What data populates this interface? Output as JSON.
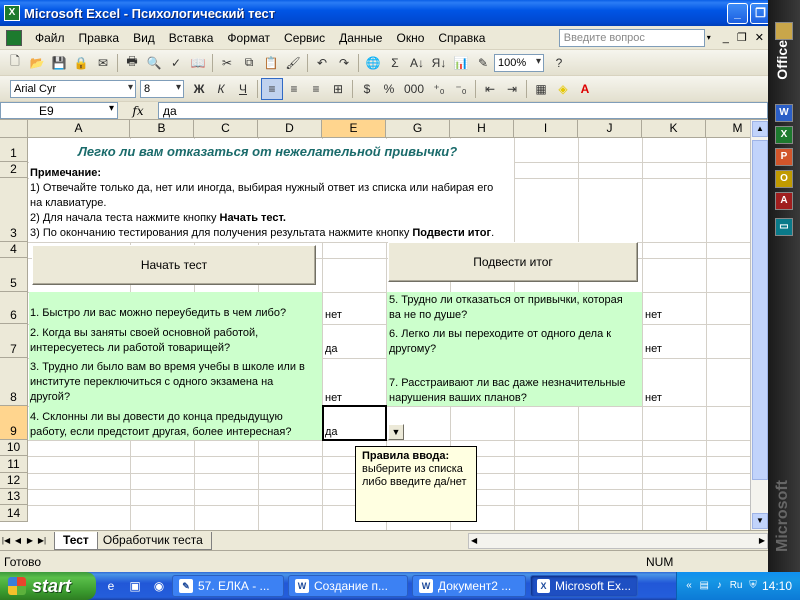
{
  "window": {
    "title": "Microsoft Excel - Психологический тест",
    "minimize": "_",
    "maximize": "❐",
    "close": "✕"
  },
  "menu": {
    "items": [
      "Файл",
      "Правка",
      "Вид",
      "Вставка",
      "Формат",
      "Сервис",
      "Данные",
      "Окно",
      "Справка"
    ],
    "help_placeholder": "Введите вопрос"
  },
  "toolbar": {
    "zoom": "100%",
    "font_name": "Arial Cyr",
    "font_size": "8",
    "bold": "Ж",
    "italic": "К",
    "underline": "Ч",
    "percent": "%",
    "thousands": "000"
  },
  "formula_bar": {
    "name_box": "E9",
    "fx": "fx",
    "content": "да"
  },
  "columns": [
    "A",
    "B",
    "C",
    "D",
    "E",
    "G",
    "H",
    "I",
    "J",
    "K",
    "M"
  ],
  "rows": [
    "1",
    "2",
    "3",
    "4",
    "5",
    "6",
    "7",
    "8",
    "9",
    "10",
    "11",
    "12",
    "13",
    "14"
  ],
  "sheet": {
    "title": "Легко ли вам отказаться от нежелательной привычки?",
    "note_heading": "Примечание:",
    "note_line1": "1) Отвечайте только да, нет или иногда, выбирая нужный ответ из списка или набирая его",
    "note_line1b": "на клавиатуре.",
    "note_line2_prefix": "2) Для начала теста нажмите кнопку ",
    "note_line2_bold": "Начать тест.",
    "note_line3_prefix": "3) По окончанию тестирования для получения результата нажмите кнопку ",
    "note_line3_bold": "Подвести итог",
    "note_line3_suffix": ".",
    "start_button": "Начать тест",
    "result_button": "Подвести итог",
    "questions": [
      {
        "q1": "1. Быстро ли вас можно переубедить в чем либо?",
        "q2": "",
        "a": "нет"
      },
      {
        "q1": "2. Когда вы заняты своей основной работой,",
        "q2": "интересуетесь ли работой товарищей?",
        "a": "да"
      },
      {
        "q1": "3. Трудно ли было вам во время учебы в школе или в",
        "q2": "институте переключиться с одного экзамена на",
        "q3": "другой?",
        "a": "нет"
      },
      {
        "q1": "4. Склонны ли вы довести до конца предыдущую",
        "q2": "работу, если предстоит другая, более интересная?",
        "a": "да"
      }
    ],
    "questions_right": [
      {
        "q1": "5. Трудно ли отказаться от привычки, которая",
        "q2": "ва не по душе?",
        "a": "нет"
      },
      {
        "q1": "6. Легко ли вы переходите от одного дела к",
        "q2": "другому?",
        "a": "нет"
      },
      {
        "q1": "7. Расстраивают ли вас даже незначительные",
        "q2": "нарушения ваших планов?",
        "a": "нет"
      }
    ],
    "tooltip_title": "Правила ввода:",
    "tooltip_line1": "выберите из списка",
    "tooltip_line2": "либо введите да/нет"
  },
  "tabs": [
    "Тест",
    "Обработчик теста"
  ],
  "status": {
    "ready": "Готово",
    "num": "NUM"
  },
  "office_bar": {
    "label": "Office",
    "watermark": "Microsoft"
  },
  "taskbar": {
    "start": "start",
    "tasks": [
      "57. ЕЛКА - ...",
      "Создание п...",
      "Документ2 ...",
      "Microsoft Ex..."
    ],
    "lang": "Ru",
    "clock": "14:10"
  }
}
